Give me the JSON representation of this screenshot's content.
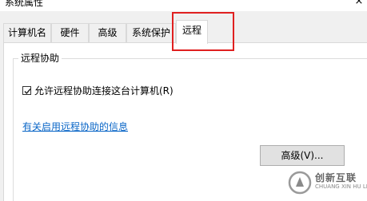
{
  "window": {
    "title": "系统属性",
    "close_glyph": "×"
  },
  "tabs": [
    {
      "label": "计算机名",
      "active": false
    },
    {
      "label": "硬件",
      "active": false
    },
    {
      "label": "高级",
      "active": false
    },
    {
      "label": "系统保护",
      "active": false
    },
    {
      "label": "远程",
      "active": true
    }
  ],
  "remote_assistance": {
    "group_title": "远程协助",
    "allow_checkbox": {
      "label": "允许远程协助连接这台计算机(R)",
      "checked": true
    },
    "help_link": "有关启用远程协助的信息",
    "advanced_button": "高级(V)..."
  },
  "watermark": {
    "name_cn": "创新互联",
    "name_en": "CHUANG XIN HU LIAN"
  },
  "colors": {
    "highlight": "#e02020",
    "link": "#0a66c7"
  }
}
